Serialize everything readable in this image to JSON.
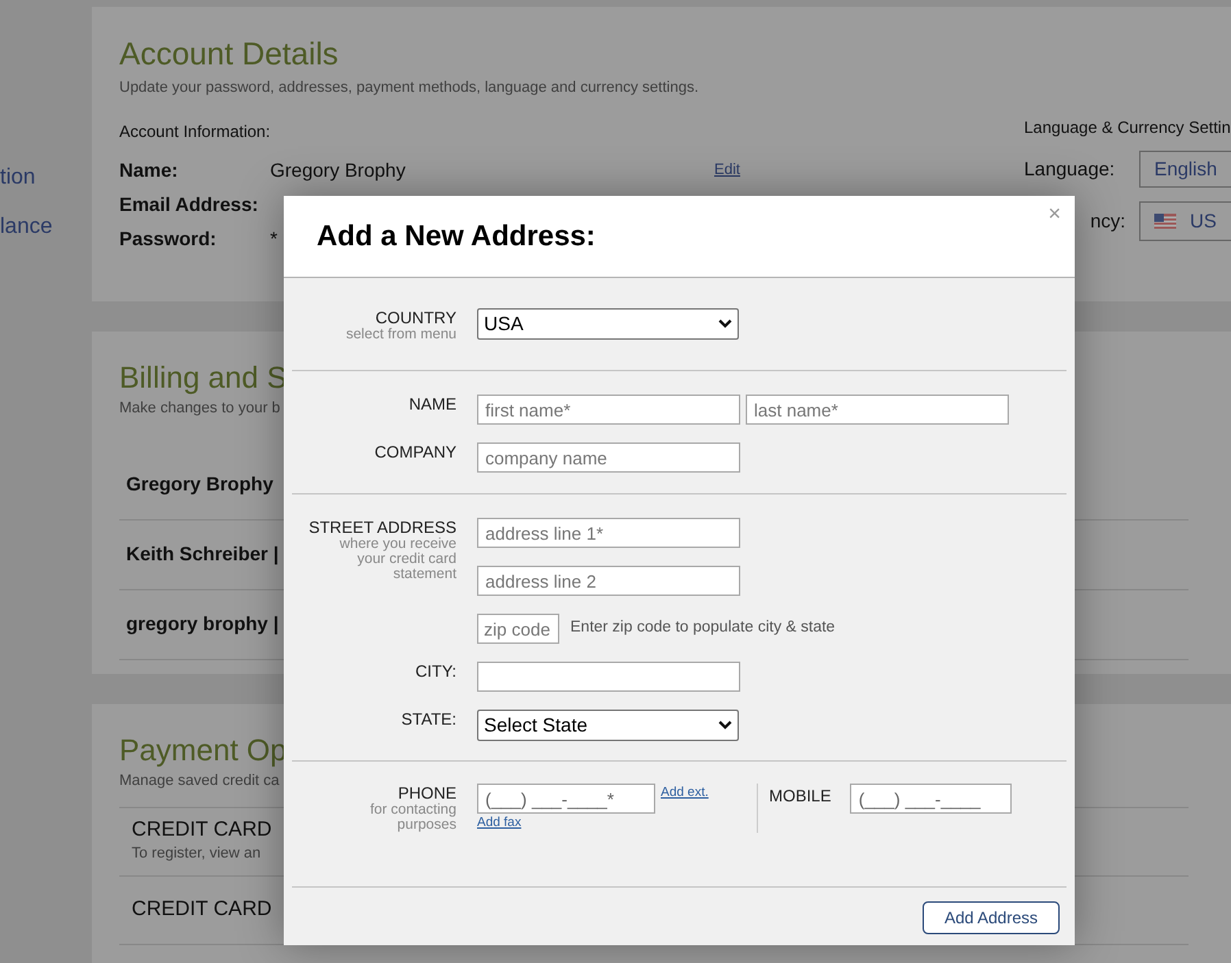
{
  "sidebar": {
    "items": [
      "tion",
      "lance"
    ]
  },
  "account": {
    "title": "Account Details",
    "subtitle": "Update your password, addresses, payment methods, language and currency settings.",
    "section_label": "Account Information:",
    "fields": [
      {
        "label": "Name:",
        "value": "Gregory Brophy",
        "action": "Edit"
      },
      {
        "label": "Email Address:"
      },
      {
        "label": "Password:",
        "value": "*"
      }
    ]
  },
  "language_settings": {
    "title": "Language & Currency Settin",
    "language_label": "Language:",
    "language": "English",
    "currency_label": "ncy:",
    "currency": "US"
  },
  "billing": {
    "title": "Billing and S",
    "subtitle": "Make changes to your b",
    "addresses": [
      "Gregory Brophy",
      "Keith Schreiber |",
      "gregory brophy |"
    ]
  },
  "payment": {
    "title": "Payment Op",
    "subtitle": "Manage saved credit ca",
    "cards": [
      {
        "title": "CREDIT CARD",
        "note": "To register, view an"
      },
      {
        "title": "CREDIT CARD"
      }
    ]
  },
  "modal": {
    "title": "Add a New Address:",
    "close": "×",
    "sections": [
      {
        "rows": [
          {
            "label": "COUNTRY",
            "hint": "select from menu",
            "controls": [
              {
                "kind": "select",
                "value": "USA"
              }
            ]
          }
        ]
      },
      {
        "rows": [
          {
            "label": "NAME",
            "controls": [
              {
                "kind": "input",
                "placeholder": "first name*"
              },
              {
                "kind": "input",
                "placeholder": "last name*"
              }
            ]
          },
          {
            "label": "COMPANY",
            "controls": [
              {
                "kind": "input",
                "placeholder": "company name"
              }
            ]
          }
        ]
      },
      {
        "rows": [
          {
            "label": "STREET ADDRESS",
            "hint": "where you receive your credit card statement",
            "controls": [
              {
                "kind": "input",
                "placeholder": "address line 1*"
              }
            ]
          },
          {
            "controls": [
              {
                "kind": "input",
                "placeholder": "address line 2"
              }
            ]
          },
          {
            "controls": [
              {
                "kind": "zip",
                "placeholder": "zip code"
              },
              {
                "kind": "note",
                "text": "Enter zip code to populate city & state"
              }
            ]
          },
          {
            "label": "CITY:",
            "controls": [
              {
                "kind": "input"
              }
            ]
          },
          {
            "label": "STATE:",
            "controls": [
              {
                "kind": "select",
                "value": "Select State"
              }
            ]
          }
        ]
      }
    ],
    "phone": {
      "label": "PHONE",
      "hint": "for contacting purposes",
      "placeholder": "(___) ___-____*",
      "ext_link": "Add ext.",
      "fax_link": "Add fax",
      "mobile_label": "MOBILE",
      "mobile_placeholder": "(___) ___-____"
    },
    "submit": "Add Address"
  }
}
